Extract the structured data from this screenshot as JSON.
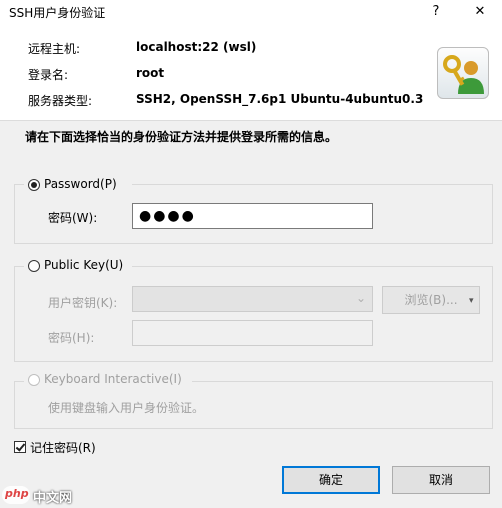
{
  "window": {
    "title": "SSH用户身份验证",
    "help_glyph": "?",
    "close_glyph": "✕"
  },
  "header": {
    "host_label": "远程主机:",
    "host_value": "localhost:22 (wsl)",
    "user_label": "登录名:",
    "user_value": "root",
    "server_label": "服务器类型:",
    "server_value": "SSH2, OpenSSH_7.6p1 Ubuntu-4ubuntu0.3"
  },
  "prompt": "请在下面选择恰当的身份验证方法并提供登录所需的信息。",
  "password_group": {
    "label": "Password(P)",
    "field_label": "密码(W):",
    "value": "●●●●",
    "selected": true
  },
  "pubkey_group": {
    "label": "Public Key(U)",
    "key_label": "用户密钥(K):",
    "key_value": "",
    "browse_label": "浏览(B)...",
    "pass_label": "密码(H):",
    "pass_value": ""
  },
  "keyboard_group": {
    "label": "Keyboard Interactive(I)",
    "desc": "使用键盘输入用户身份验证。"
  },
  "remember": {
    "label": "记住密码(R)",
    "checked": true
  },
  "buttons": {
    "ok": "确定",
    "cancel": "取消"
  },
  "watermark": "中文网",
  "watermark_logo": "php",
  "colors": {
    "accent": "#0078d7",
    "background": "#f0f0f0"
  }
}
